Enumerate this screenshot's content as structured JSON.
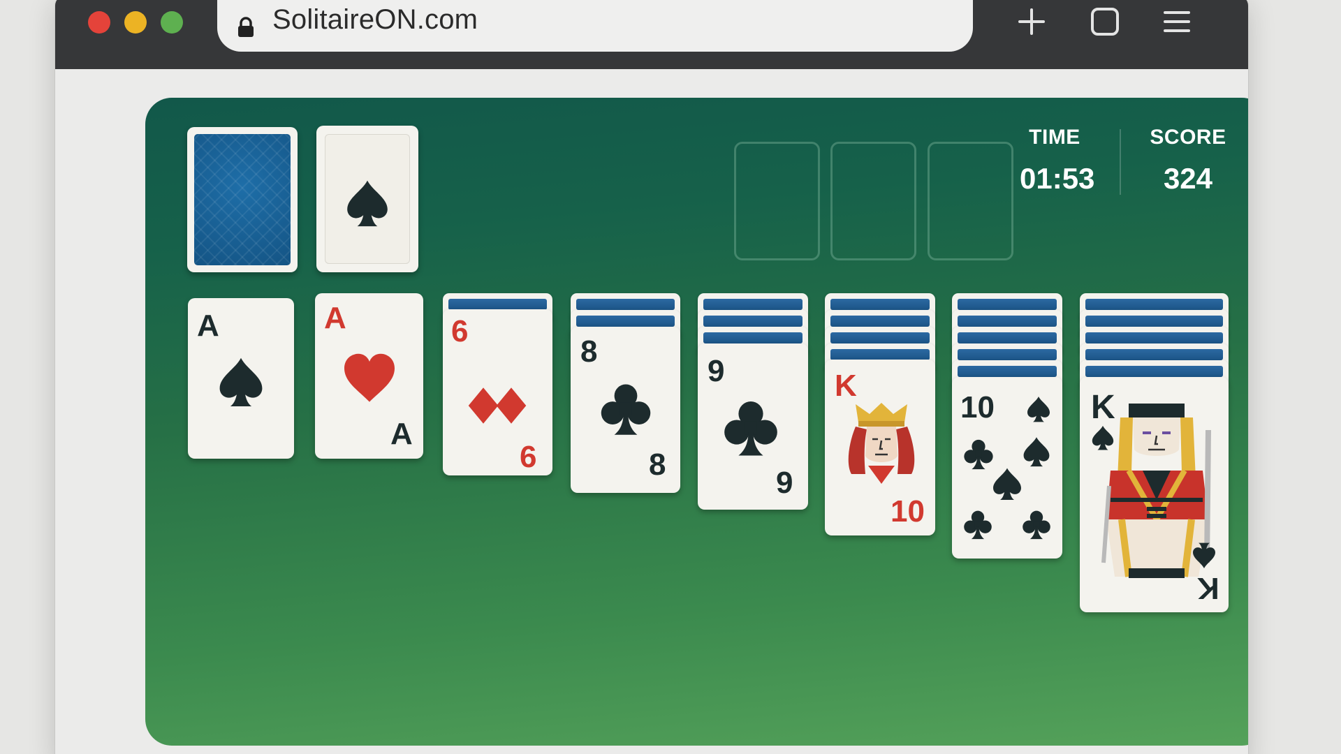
{
  "browser": {
    "url": "SolitaireON.com",
    "icons": [
      "lock-icon",
      "plus-icon",
      "tabs-icon",
      "menu-icon"
    ]
  },
  "game": {
    "stats": {
      "time_label": "TIME",
      "time_value": "01:53",
      "score_label": "SCORE",
      "score_value": "324"
    },
    "stock": {
      "face_down": true
    },
    "waste": {
      "suit": "spade"
    },
    "foundations": [
      {},
      {},
      {}
    ],
    "tableau": [
      {
        "hidden": 0,
        "rank": "A",
        "suit": "spade",
        "bottom": ""
      },
      {
        "hidden": 0,
        "rank": "A",
        "suit": "heart",
        "bottom": "A"
      },
      {
        "hidden": 1,
        "rank": "6",
        "suit": "diamond",
        "bottom": "6"
      },
      {
        "hidden": 2,
        "rank": "8",
        "suit": "club",
        "bottom": "8"
      },
      {
        "hidden": 3,
        "rank": "9",
        "suit": "club",
        "bottom": "9"
      },
      {
        "hidden": 4,
        "rank": "K",
        "suit": "heart",
        "bottom": "10"
      },
      {
        "hidden": 5,
        "rank": "10",
        "suit": "spade",
        "bottom": ""
      },
      {
        "hidden": 5,
        "rank": "K",
        "suit": "spade",
        "bottom": "K"
      }
    ],
    "colors": {
      "felt_top": "#12584a",
      "felt_bottom": "#55a25a",
      "card": "#f4f3ee",
      "red": "#d1392f",
      "black": "#1d2b2d",
      "card_back": "#1a5f94"
    }
  }
}
